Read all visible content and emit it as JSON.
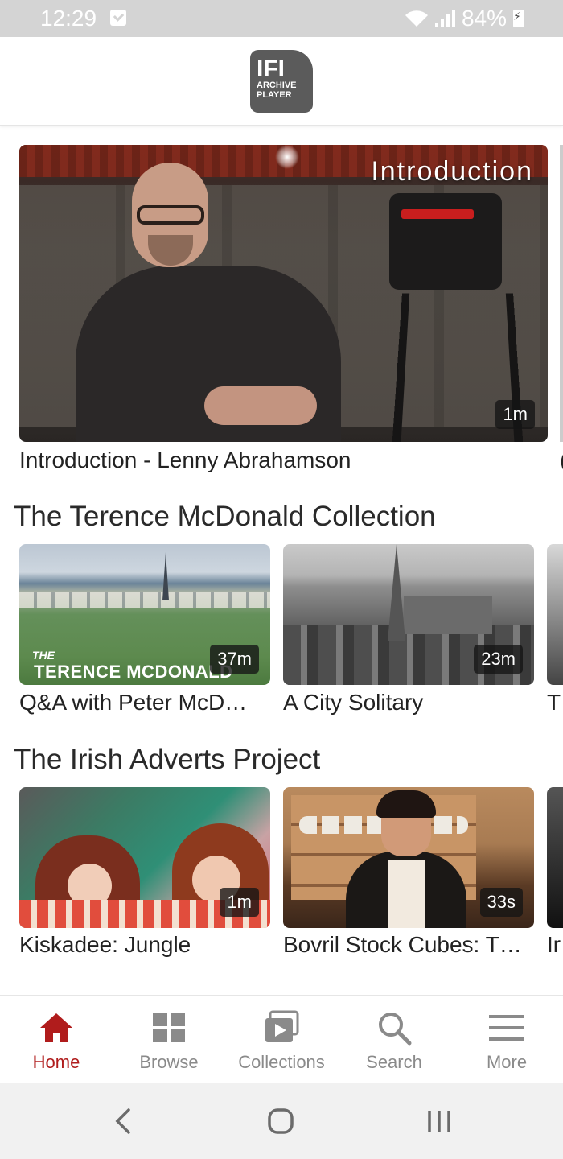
{
  "status_bar": {
    "time": "12:29",
    "battery_text": "84%"
  },
  "app": {
    "logo_line1": "IFI",
    "logo_line2": "ARCHIVE",
    "logo_line3": "PLAYER"
  },
  "hero": {
    "overlay_label": "Introduction",
    "duration": "1m",
    "title": "Introduction - Lenny Abrahamson"
  },
  "sections": [
    {
      "title": "The Terence McDonald Collection",
      "items": [
        {
          "title": "Q&A with Peter McD…",
          "duration": "37m",
          "thumb_text_top": "THE",
          "thumb_text_bottom": "TERENCE MCDONALD"
        },
        {
          "title": "A City Solitary",
          "duration": "23m"
        },
        {
          "title": "T"
        }
      ]
    },
    {
      "title": "The Irish Adverts Project",
      "items": [
        {
          "title": "Kiskadee: Jungle",
          "duration": "1m"
        },
        {
          "title": "Bovril Stock Cubes: T…",
          "duration": "33s"
        },
        {
          "title": "Ir"
        }
      ]
    }
  ],
  "bottom_nav": [
    {
      "label": "Home",
      "icon": "home-icon",
      "active": true
    },
    {
      "label": "Browse",
      "icon": "grid-icon",
      "active": false
    },
    {
      "label": "Collections",
      "icon": "collections-icon",
      "active": false
    },
    {
      "label": "Search",
      "icon": "search-icon",
      "active": false
    },
    {
      "label": "More",
      "icon": "menu-icon",
      "active": false
    }
  ],
  "colors": {
    "accent": "#b01c1c",
    "inactive": "#8a8a8a",
    "status_bar": "#d4d4d4"
  }
}
